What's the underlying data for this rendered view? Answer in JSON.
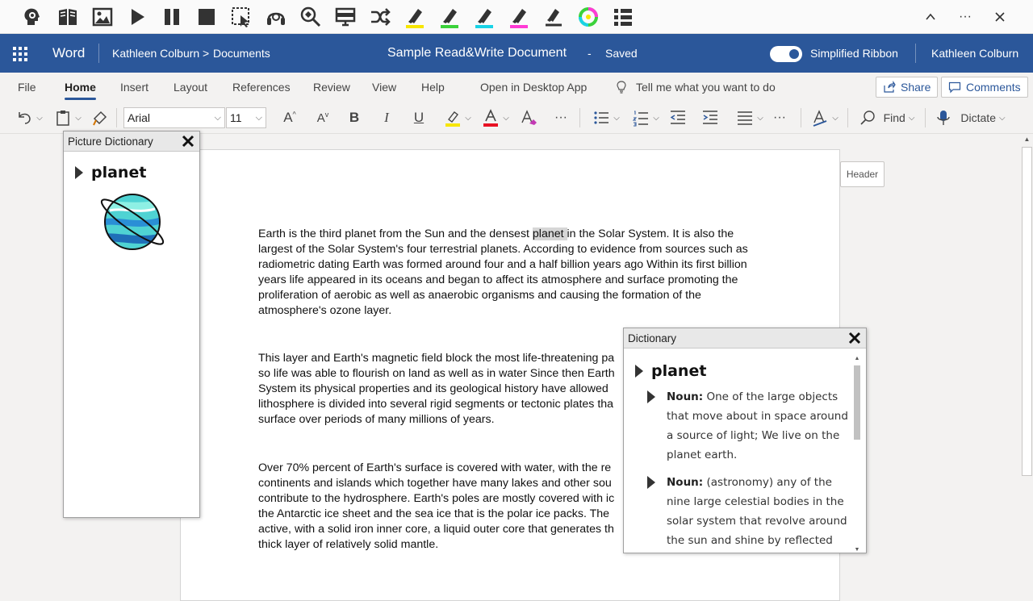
{
  "readwrite_toolbar": {
    "buttons": [
      "speak-head-icon",
      "dictionary-book-icon",
      "picture-dictionary-icon",
      "play-icon",
      "pause-icon",
      "stop-icon",
      "screenshot-reader-icon",
      "audio-maker-icon",
      "vocabulary-icon",
      "screen-mask-icon",
      "translator-icon",
      "highlight-yellow-icon",
      "highlight-green-icon",
      "highlight-cyan-icon",
      "highlight-pink-icon",
      "clear-highlights-icon",
      "check-it-icon",
      "collect-highlights-icon"
    ],
    "highlight_colors": {
      "yellow": "#f7e600",
      "green": "#3bd23b",
      "cyan": "#19d3e6",
      "pink": "#ff3ad5"
    }
  },
  "window_controls": {
    "collapse": "^",
    "more": "···",
    "close": "✕"
  },
  "header": {
    "app_name": "Word",
    "user": "Kathleen Colburn",
    "breadcrumb_sep": ">",
    "folder": "Documents",
    "doc_title": "Sample Read&Write Document",
    "title_sep": "-",
    "save_status": "Saved",
    "simplified_ribbon_label": "Simplified Ribbon",
    "account_name": "Kathleen Colburn",
    "brand_color": "#2b579a"
  },
  "tabs": {
    "items": [
      "File",
      "Home",
      "Insert",
      "Layout",
      "References",
      "Review",
      "View",
      "Help",
      "Open in Desktop App"
    ],
    "active": "Home",
    "tell_me": "Tell me what you want to do",
    "share": "Share",
    "comments": "Comments"
  },
  "ribbon": {
    "font_name": "Arial",
    "font_size": "11",
    "find_label": "Find",
    "dictate_label": "Dictate",
    "more": "···"
  },
  "document": {
    "header_tag": "Header",
    "para1_before": "Earth is the third planet from the Sun and the densest ",
    "para1_hl": "planet ",
    "para1_after": "in the Solar System. It is also the largest of the Solar System's four terrestrial planets. According to evidence from sources such as radiometric dating Earth was formed around four and a half billion years ago Within its first billion years life appeared in its oceans and began to affect its atmosphere and surface promoting the proliferation of aerobic as well as anaerobic organisms and causing the formation of the atmosphere's ozone layer.",
    "para2": "This layer and Earth's magnetic field block the most life-threatening pa so life was able to flourish on land as well as in water Since then Earth System its physical properties and its geological history have allowed lithosphere is divided into several rigid segments or tectonic plates tha surface over periods of many millions of years.",
    "para3": "Over 70% percent of Earth's surface is covered with water, with the re continents and islands which together have many lakes and other sou contribute to the hydrosphere. Earth's poles are mostly covered with ic the Antarctic ice sheet and the sea ice that is the polar ice packs. The active, with a solid iron inner core, a liquid outer core that generates th thick layer of relatively solid mantle."
  },
  "picture_dictionary": {
    "title": "Picture Dictionary",
    "word": "planet",
    "image_icon": "planet-icon"
  },
  "dictionary": {
    "title": "Dictionary",
    "word": "planet",
    "definitions": [
      {
        "pos": "Noun:",
        "text": "One of the large objects that move about in space around a source of light; We live on the planet earth."
      },
      {
        "pos": "Noun:",
        "text": "(astronomy) any of the nine large celestial bodies in the solar system that revolve around the sun and shine by reflected"
      }
    ]
  }
}
